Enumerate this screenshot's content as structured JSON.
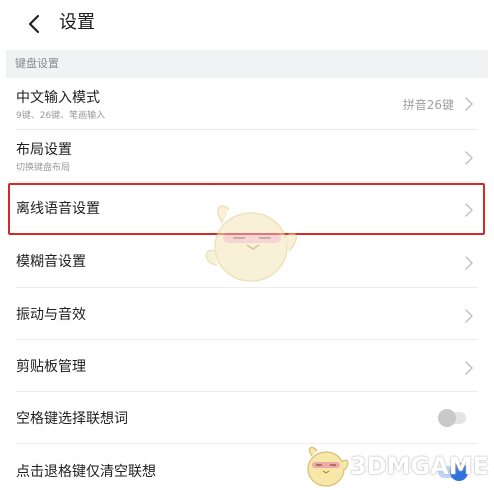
{
  "header": {
    "title": "设置",
    "back_icon": "chevron-left-icon"
  },
  "section": {
    "label": "键盘设置"
  },
  "rows": [
    {
      "title": "中文输入模式",
      "subtitle": "9键、26键、笔画输入",
      "value": "拼音26键",
      "control": "chevron"
    },
    {
      "title": "布局设置",
      "subtitle": "切换键盘布局",
      "control": "chevron"
    },
    {
      "title": "离线语音设置",
      "control": "chevron",
      "highlighted": true
    },
    {
      "title": "模糊音设置",
      "control": "chevron"
    },
    {
      "title": "振动与音效",
      "control": "chevron"
    },
    {
      "title": "剪贴板管理",
      "control": "chevron"
    },
    {
      "title": "空格键选择联想词",
      "control": "toggle",
      "toggle_on": false
    },
    {
      "title": "点击退格键仅清空联想",
      "control": "toggle",
      "toggle_on": true
    }
  ],
  "highlight": {
    "color": "#d22a2a"
  },
  "watermark": {
    "text": "3DMGAME",
    "icon": "mascot-icon"
  },
  "colors": {
    "section_bg": "#f1f2f4",
    "divider": "#ececec",
    "text_primary": "#1f1f1f",
    "text_secondary": "#9a9a9a"
  }
}
